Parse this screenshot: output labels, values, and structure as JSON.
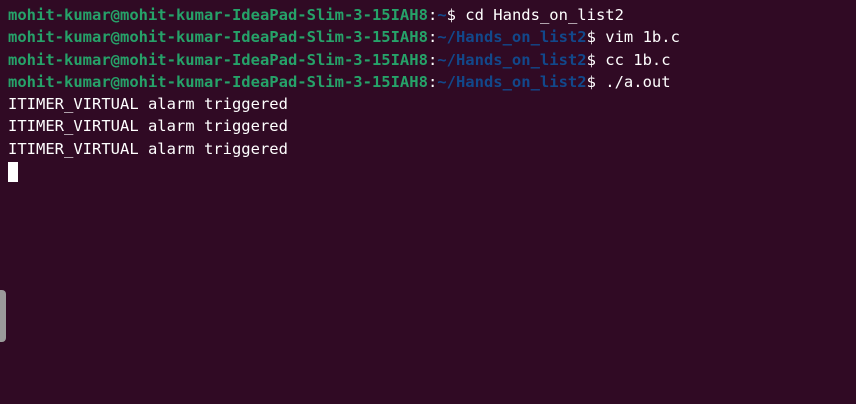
{
  "terminal": {
    "prompt_host": "mohit-kumar@mohit-kumar-IdeaPad-Slim-3-15IAH8",
    "lines": [
      {
        "path": "~",
        "dollar": "$ ",
        "command": "cd Hands_on_list2"
      },
      {
        "path": "~/Hands_on_list2",
        "dollar": "$ ",
        "command": "vim 1b.c"
      },
      {
        "path": "~/Hands_on_list2",
        "dollar": "$ ",
        "command": "cc 1b.c"
      },
      {
        "path": "~/Hands_on_list2",
        "dollar": "$ ",
        "command": "./a.out"
      }
    ],
    "output": [
      "ITIMER_VIRTUAL alarm triggered",
      "ITIMER_VIRTUAL alarm triggered",
      "ITIMER_VIRTUAL alarm triggered"
    ]
  },
  "colors": {
    "background": "#300a24",
    "prompt_user": "#26a269",
    "prompt_path": "#12488b",
    "text": "#ffffff"
  }
}
